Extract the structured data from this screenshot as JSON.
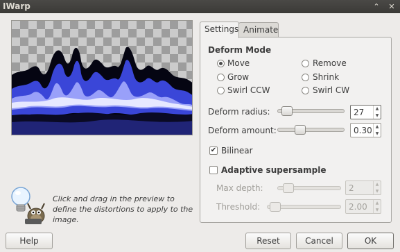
{
  "window": {
    "title": "IWarp",
    "buttons": {
      "scroll_label": "⌃",
      "close_label": "✕"
    }
  },
  "hint": {
    "text": "Click and drag in the preview to define the distortions to apply to the image."
  },
  "tabs": [
    {
      "label": "Settings",
      "active": true
    },
    {
      "label": "Animate",
      "active": false
    }
  ],
  "settings": {
    "deform_mode": {
      "heading": "Deform Mode",
      "options": [
        {
          "label": "Move",
          "selected": true
        },
        {
          "label": "Remove",
          "selected": false
        },
        {
          "label": "Grow",
          "selected": false
        },
        {
          "label": "Shrink",
          "selected": false
        },
        {
          "label": "Swirl CCW",
          "selected": false
        },
        {
          "label": "Swirl CW",
          "selected": false
        }
      ]
    },
    "deform_radius": {
      "label": "Deform radius:",
      "value": "27",
      "fraction": 0.06
    },
    "deform_amount": {
      "label": "Deform amount:",
      "value": "0.30",
      "fraction": 0.3
    },
    "bilinear": {
      "label": "Bilinear",
      "checked": true
    },
    "adaptive_supersample": {
      "label": "Adaptive supersample",
      "checked": false
    },
    "max_depth": {
      "label": "Max depth:",
      "value": "2",
      "fraction": 0.1
    },
    "threshold": {
      "label": "Threshold:",
      "value": "2.00",
      "fraction": 0.03
    }
  },
  "footer": {
    "help": "Help",
    "reset": "Reset",
    "cancel": "Cancel",
    "ok": "OK"
  },
  "colors": {
    "preview_glow": "#3a46d8",
    "preview_core": "#e6e8ff",
    "checker_dark": "#9d9d9d",
    "checker_light": "#cbcbcb"
  }
}
